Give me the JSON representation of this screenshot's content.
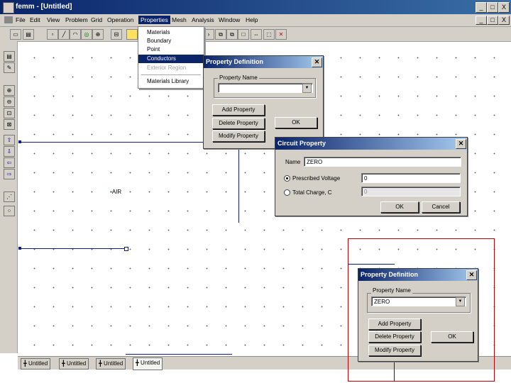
{
  "window": {
    "title": "femm - [Untitled]",
    "controls": [
      "_",
      "□",
      "X"
    ],
    "child_controls": [
      "_",
      "□",
      "X"
    ]
  },
  "menu": [
    "File",
    "Edit",
    "View",
    "Problem",
    "Grid",
    "Operation",
    "Properties",
    "Mesh",
    "Analysis",
    "Window",
    "Help"
  ],
  "properties_menu": {
    "items": [
      "Materials",
      "Boundary",
      "Point",
      "Conductors",
      "Exterior Region",
      "Materials Library"
    ],
    "selected": "Conductors",
    "disabled": "Exterior Region"
  },
  "canvas": {
    "label": "AIR"
  },
  "property_definition_top": {
    "title": "Property Definition",
    "group_label": "Property Name",
    "name_value": "",
    "buttons": [
      "Add Property",
      "Delete Property",
      "Modify Property"
    ],
    "ok_label": "OK"
  },
  "circuit_property": {
    "title": "Circuit Property",
    "name_label": "Name",
    "name_value": "ZERO",
    "voltage_label": "Prescribed Voltage",
    "voltage_value": "0",
    "charge_label": "Total Charge, C",
    "charge_value": "0",
    "ok_label": "OK",
    "cancel_label": "Cancel"
  },
  "property_definition_bottom": {
    "title": "Property Definition",
    "group_label": "Property Name",
    "name_value": "ZERO",
    "buttons": [
      "Add Property",
      "Delete Property",
      "Modify Property"
    ],
    "ok_label": "OK"
  },
  "tabs": [
    "Untitled",
    "Untitled",
    "Untitled",
    "Untitled"
  ],
  "colors": {
    "titlebar": "#0a246a",
    "highlight_box": "#c00000",
    "geometry_line": "#102080"
  }
}
